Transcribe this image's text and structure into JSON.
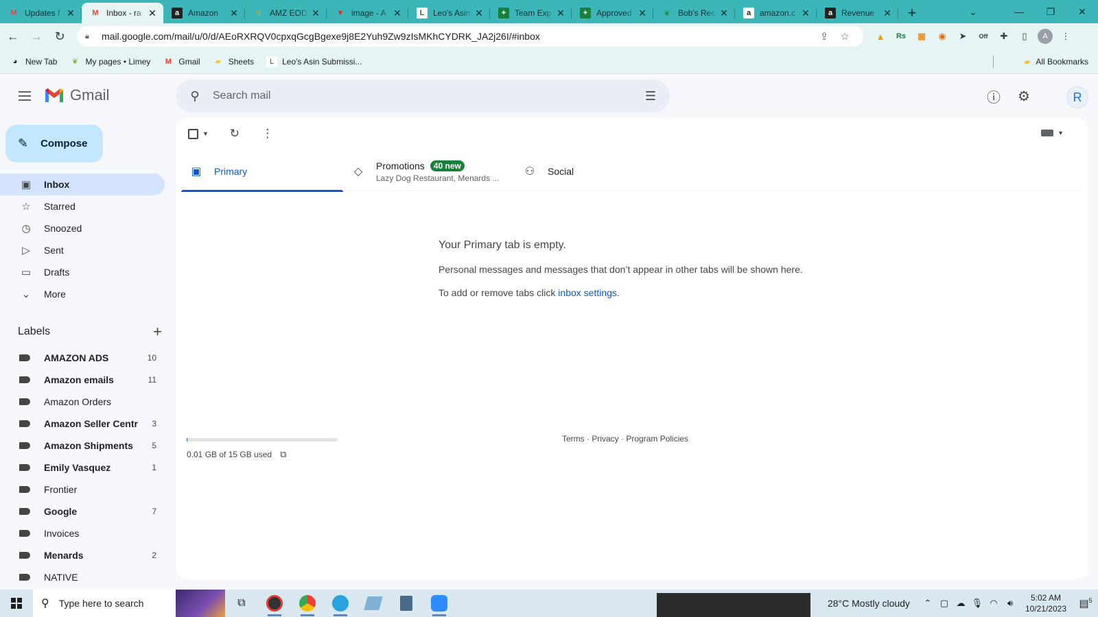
{
  "browser": {
    "tabs": [
      {
        "title": "Updates f",
        "icon": "gmail-icon"
      },
      {
        "title": "Inbox - ra",
        "icon": "gmail-icon",
        "active": true
      },
      {
        "title": "Amazon",
        "icon": "amazon-icon"
      },
      {
        "title": "AMZ EOD",
        "icon": "pencil-icon"
      },
      {
        "title": "image - A",
        "icon": "v-icon"
      },
      {
        "title": "Leo's Asin",
        "icon": "leo-icon"
      },
      {
        "title": "Team Exp",
        "icon": "sheets-icon"
      },
      {
        "title": "Approved",
        "icon": "sheets-icon"
      },
      {
        "title": "Bob's Rec",
        "icon": "leaf-icon"
      },
      {
        "title": "amazon.c",
        "icon": "amazon-icon"
      },
      {
        "title": "Revenue",
        "icon": "amazon-icon"
      }
    ],
    "url": "mail.google.com/mail/u/0/d/AEoRXRQV0cpxqGcgBgexe9j8E2Yuh9Zw9zIsMKhCYDRK_JA2j26I/#inbox",
    "profile_initial": "A",
    "extension_off_badge": "Off",
    "bookmarks": [
      {
        "label": "New Tab"
      },
      {
        "label": "My pages • Limey"
      },
      {
        "label": "Gmail"
      },
      {
        "label": "Sheets"
      },
      {
        "label": "Leo's Asin Submissi..."
      }
    ],
    "all_bookmarks": "All Bookmarks"
  },
  "gmail": {
    "brand": "Gmail",
    "search_placeholder": "Search mail",
    "avatar_initial": "R",
    "compose": "Compose",
    "nav": [
      {
        "label": "Inbox",
        "icon": "inbox-icon",
        "active": true
      },
      {
        "label": "Starred",
        "icon": "star-icon"
      },
      {
        "label": "Snoozed",
        "icon": "clock-icon"
      },
      {
        "label": "Sent",
        "icon": "send-icon"
      },
      {
        "label": "Drafts",
        "icon": "draft-icon"
      },
      {
        "label": "More",
        "icon": "chevron-down-icon"
      }
    ],
    "labels_title": "Labels",
    "labels": [
      {
        "name": "AMAZON ADS",
        "count": "10",
        "bold": true
      },
      {
        "name": "Amazon emails",
        "count": "11",
        "bold": true
      },
      {
        "name": "Amazon Orders",
        "count": "",
        "bold": false
      },
      {
        "name": "Amazon Seller Centr",
        "count": "3",
        "bold": true
      },
      {
        "name": "Amazon Shipments",
        "count": "5",
        "bold": true
      },
      {
        "name": "Emily Vasquez",
        "count": "1",
        "bold": true
      },
      {
        "name": "Frontier",
        "count": "",
        "bold": false
      },
      {
        "name": "Google",
        "count": "7",
        "bold": true
      },
      {
        "name": "Invoices",
        "count": "",
        "bold": false
      },
      {
        "name": "Menards",
        "count": "2",
        "bold": true
      },
      {
        "name": "NATIVE",
        "count": "",
        "bold": false
      }
    ],
    "tabs": {
      "primary": "Primary",
      "promotions": "Promotions",
      "promotions_badge": "40 new",
      "promotions_snippet": "Lazy Dog Restaurant, Menards ...",
      "social": "Social"
    },
    "empty": {
      "title": "Your Primary tab is empty.",
      "line1": "Personal messages and messages that don’t appear in other tabs will be shown here.",
      "line2_prefix": "To add or remove tabs click ",
      "line2_link": "inbox settings",
      "line2_suffix": "."
    },
    "storage": {
      "text": "0.01 GB of 15 GB used",
      "used_fraction": 0.001
    },
    "footer": {
      "terms": "Terms",
      "privacy": "Privacy",
      "policies": "Program Policies",
      "sep": " · "
    }
  },
  "taskbar": {
    "search_placeholder": "Type here to search",
    "weather": "28°C  Mostly cloudy",
    "time": "5:02 AM",
    "date": "10/21/2023",
    "notification_count": "5"
  }
}
